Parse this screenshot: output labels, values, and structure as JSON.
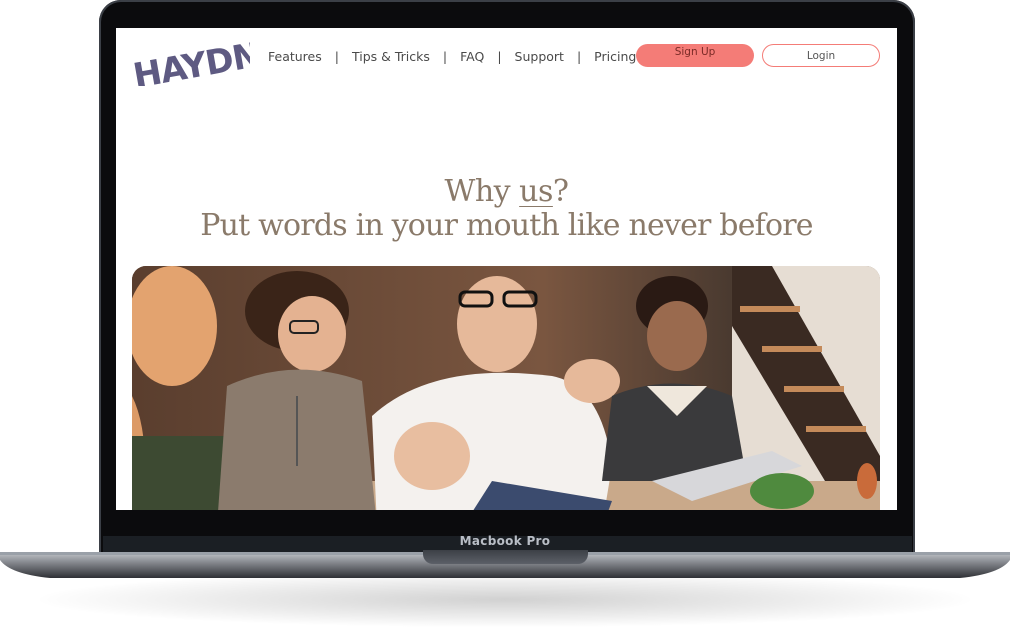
{
  "device": {
    "label": "Macbook Pro"
  },
  "site": {
    "logo": "HAYDN",
    "nav": {
      "items": [
        {
          "label": "Features"
        },
        {
          "label": "Tips & Tricks"
        },
        {
          "label": "FAQ"
        },
        {
          "label": "Support"
        },
        {
          "label": "Pricing"
        }
      ],
      "separator": "|"
    },
    "buttons": {
      "signup": "Sign Up",
      "login": "Login"
    },
    "hero": {
      "line1_before": "Why ",
      "line1_underlined": "us",
      "line1_after": "?",
      "line2": "Put words in your mouth like never before"
    }
  },
  "colors": {
    "accent": "#f47c77",
    "logo": "#5e5a82",
    "headline": "#8a7a6a",
    "laptop_body": "#0b0b0d"
  }
}
